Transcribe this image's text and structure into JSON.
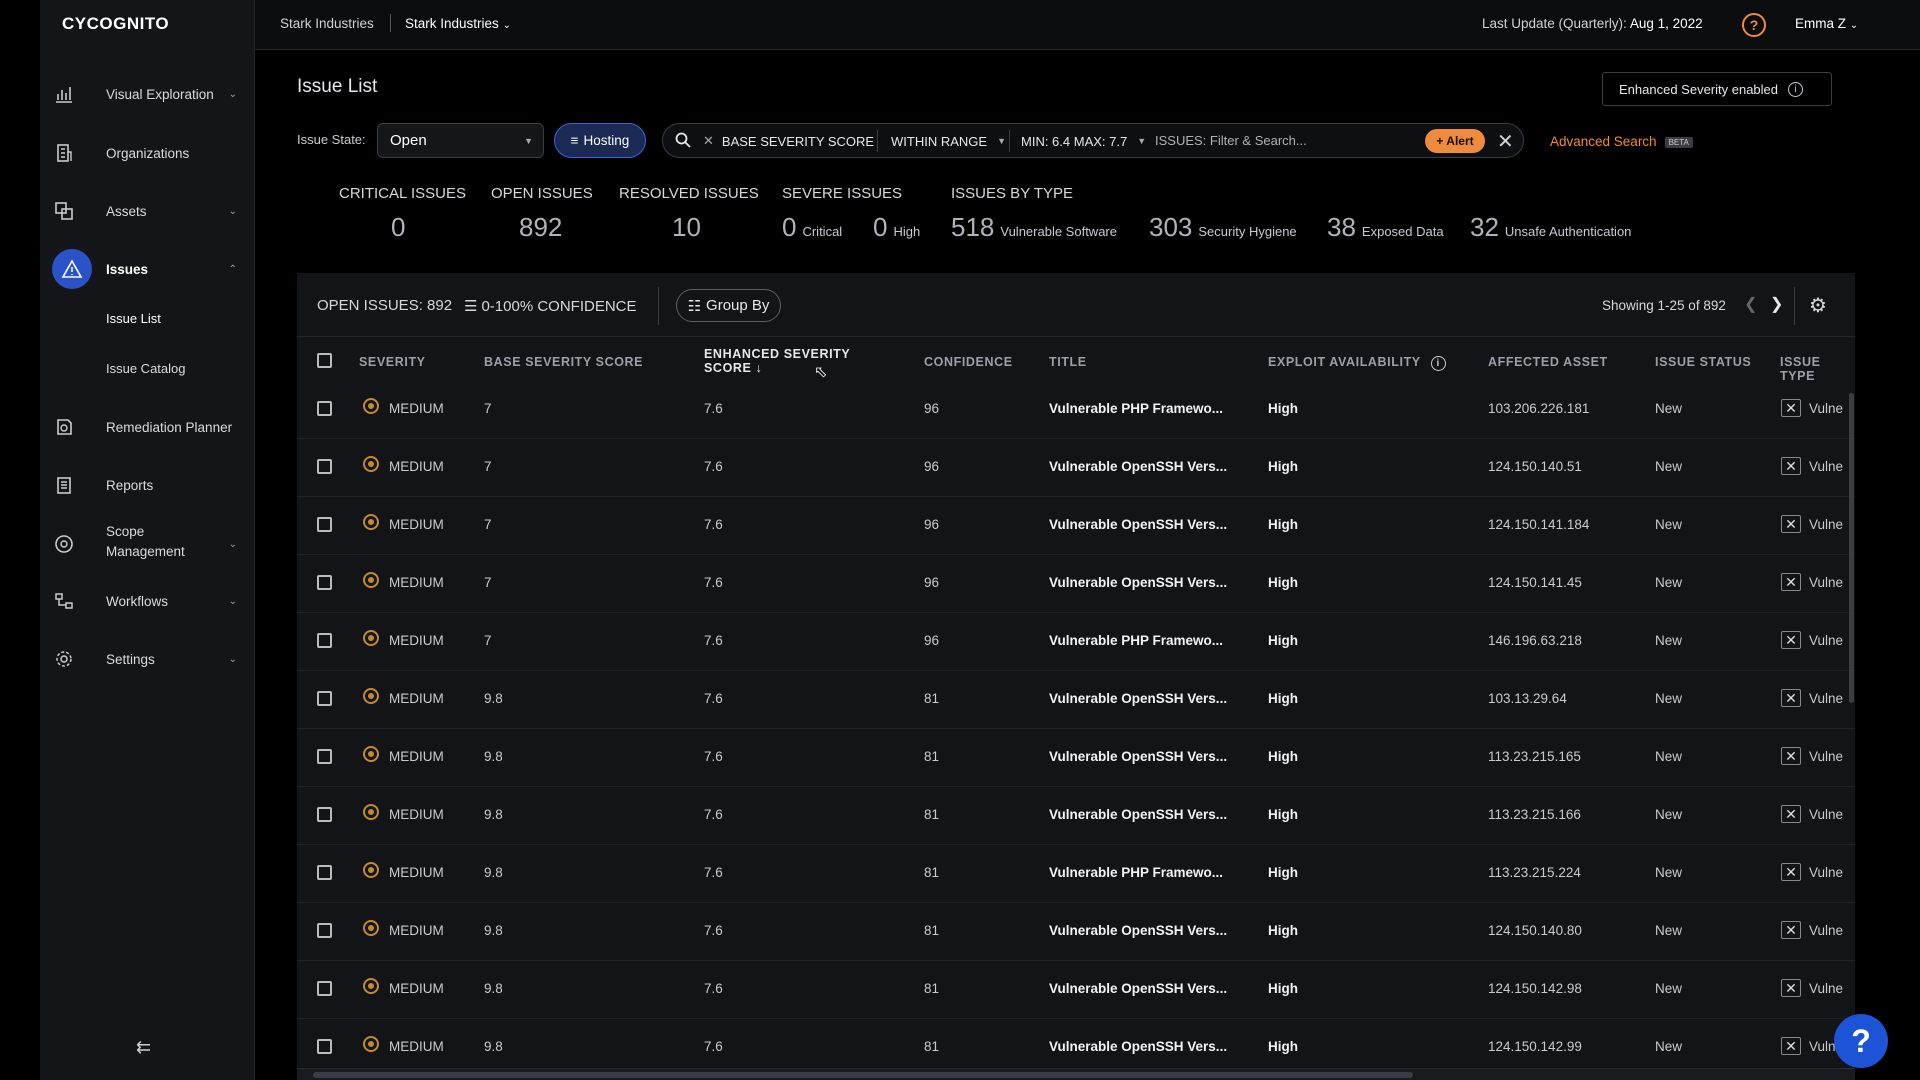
{
  "app": {
    "logo": "CYCOGNITO"
  },
  "sidebar": {
    "items": [
      {
        "label": "Visual Exploration",
        "icon": "bar-chart-icon",
        "chevron": "⌄"
      },
      {
        "label": "Organizations",
        "icon": "building-icon",
        "chevron": ""
      },
      {
        "label": "Assets",
        "icon": "assets-icon",
        "chevron": "⌄"
      },
      {
        "label": "Issues",
        "icon": "warning-icon",
        "chevron": "⌃"
      },
      {
        "label": "Remediation Planner",
        "icon": "planner-icon",
        "chevron": ""
      },
      {
        "label": "Reports",
        "icon": "report-icon",
        "chevron": ""
      },
      {
        "label": "Scope",
        "label2": "Management",
        "icon": "scope-icon",
        "chevron": "⌄"
      },
      {
        "label": "Workflows",
        "icon": "workflow-icon",
        "chevron": "⌄"
      },
      {
        "label": "Settings",
        "icon": "gear-icon",
        "chevron": "⌄"
      }
    ],
    "sub_items": [
      "Issue List",
      "Issue Catalog"
    ],
    "collapse": "⇇"
  },
  "topbar": {
    "crumb1": "Stark Industries",
    "crumb2": "Stark Industries",
    "last_update_label": "Last Update (Quarterly):",
    "last_update_value": "Aug 1, 2022",
    "user": "Emma Z"
  },
  "page": {
    "title": "Issue List",
    "enhanced_severity": "Enhanced Severity enabled"
  },
  "filters": {
    "state_label": "Issue State:",
    "state_value": "Open",
    "hosting": "Hosting",
    "chip_field": "BASE SEVERITY SCORE",
    "chip_op": "WITHIN RANGE",
    "chip_value": "MIN: 6.4 MAX: 7.7",
    "search_placeholder": "ISSUES: Filter & Search...",
    "alert": "+ Alert",
    "advanced": "Advanced Search",
    "beta": "BETA"
  },
  "stats": {
    "critical_label": "CRITICAL ISSUES",
    "critical_value": "0",
    "open_label": "OPEN ISSUES",
    "open_value": "892",
    "resolved_label": "RESOLVED ISSUES",
    "resolved_value": "10",
    "severe_label": "SEVERE ISSUES",
    "severe_critical_value": "0",
    "severe_critical_label": "Critical",
    "severe_high_value": "0",
    "severe_high_label": "High",
    "bytype_label": "ISSUES BY TYPE",
    "types": [
      {
        "value": "518",
        "label": "Vulnerable Software"
      },
      {
        "value": "303",
        "label": "Security Hygiene"
      },
      {
        "value": "38",
        "label": "Exposed Data"
      },
      {
        "value": "32",
        "label": "Unsafe Authentication"
      }
    ]
  },
  "table": {
    "open_issues": "OPEN ISSUES: 892",
    "confidence": "0-100% CONFIDENCE",
    "group_by": "Group By",
    "showing": "Showing 1-25 of 892",
    "headers": {
      "severity": "SEVERITY",
      "base": "BASE SEVERITY SCORE",
      "enhanced1": "ENHANCED SEVERITY",
      "enhanced2": "SCORE ↓",
      "confidence": "CONFIDENCE",
      "title": "TITLE",
      "exploit": "EXPLOIT AVAILABILITY",
      "asset": "AFFECTED ASSET",
      "status": "ISSUE STATUS",
      "type": "ISSUE TYPE"
    },
    "rows": [
      {
        "severity": "MEDIUM",
        "base": "7",
        "enhanced": "7.6",
        "confidence": "96",
        "title": "Vulnerable PHP Framewo...",
        "exploit": "High",
        "asset": "103.206.226.181",
        "status": "New",
        "type": "Vulne"
      },
      {
        "severity": "MEDIUM",
        "base": "7",
        "enhanced": "7.6",
        "confidence": "96",
        "title": "Vulnerable OpenSSH Vers...",
        "exploit": "High",
        "asset": "124.150.140.51",
        "status": "New",
        "type": "Vulne"
      },
      {
        "severity": "MEDIUM",
        "base": "7",
        "enhanced": "7.6",
        "confidence": "96",
        "title": "Vulnerable OpenSSH Vers...",
        "exploit": "High",
        "asset": "124.150.141.184",
        "status": "New",
        "type": "Vulne"
      },
      {
        "severity": "MEDIUM",
        "base": "7",
        "enhanced": "7.6",
        "confidence": "96",
        "title": "Vulnerable OpenSSH Vers...",
        "exploit": "High",
        "asset": "124.150.141.45",
        "status": "New",
        "type": "Vulne"
      },
      {
        "severity": "MEDIUM",
        "base": "7",
        "enhanced": "7.6",
        "confidence": "96",
        "title": "Vulnerable PHP Framewo...",
        "exploit": "High",
        "asset": "146.196.63.218",
        "status": "New",
        "type": "Vulne"
      },
      {
        "severity": "MEDIUM",
        "base": "9.8",
        "enhanced": "7.6",
        "confidence": "81",
        "title": "Vulnerable OpenSSH Vers...",
        "exploit": "High",
        "asset": "103.13.29.64",
        "status": "New",
        "type": "Vulne"
      },
      {
        "severity": "MEDIUM",
        "base": "9.8",
        "enhanced": "7.6",
        "confidence": "81",
        "title": "Vulnerable OpenSSH Vers...",
        "exploit": "High",
        "asset": "113.23.215.165",
        "status": "New",
        "type": "Vulne"
      },
      {
        "severity": "MEDIUM",
        "base": "9.8",
        "enhanced": "7.6",
        "confidence": "81",
        "title": "Vulnerable OpenSSH Vers...",
        "exploit": "High",
        "asset": "113.23.215.166",
        "status": "New",
        "type": "Vulne"
      },
      {
        "severity": "MEDIUM",
        "base": "9.8",
        "enhanced": "7.6",
        "confidence": "81",
        "title": "Vulnerable PHP Framewo...",
        "exploit": "High",
        "asset": "113.23.215.224",
        "status": "New",
        "type": "Vulne"
      },
      {
        "severity": "MEDIUM",
        "base": "9.8",
        "enhanced": "7.6",
        "confidence": "81",
        "title": "Vulnerable OpenSSH Vers...",
        "exploit": "High",
        "asset": "124.150.140.80",
        "status": "New",
        "type": "Vulne"
      },
      {
        "severity": "MEDIUM",
        "base": "9.8",
        "enhanced": "7.6",
        "confidence": "81",
        "title": "Vulnerable OpenSSH Vers...",
        "exploit": "High",
        "asset": "124.150.142.98",
        "status": "New",
        "type": "Vulne"
      },
      {
        "severity": "MEDIUM",
        "base": "9.8",
        "enhanced": "7.6",
        "confidence": "81",
        "title": "Vulnerable OpenSSH Vers...",
        "exploit": "High",
        "asset": "124.150.142.99",
        "status": "New",
        "type": "Vulne"
      }
    ]
  },
  "help": "?"
}
